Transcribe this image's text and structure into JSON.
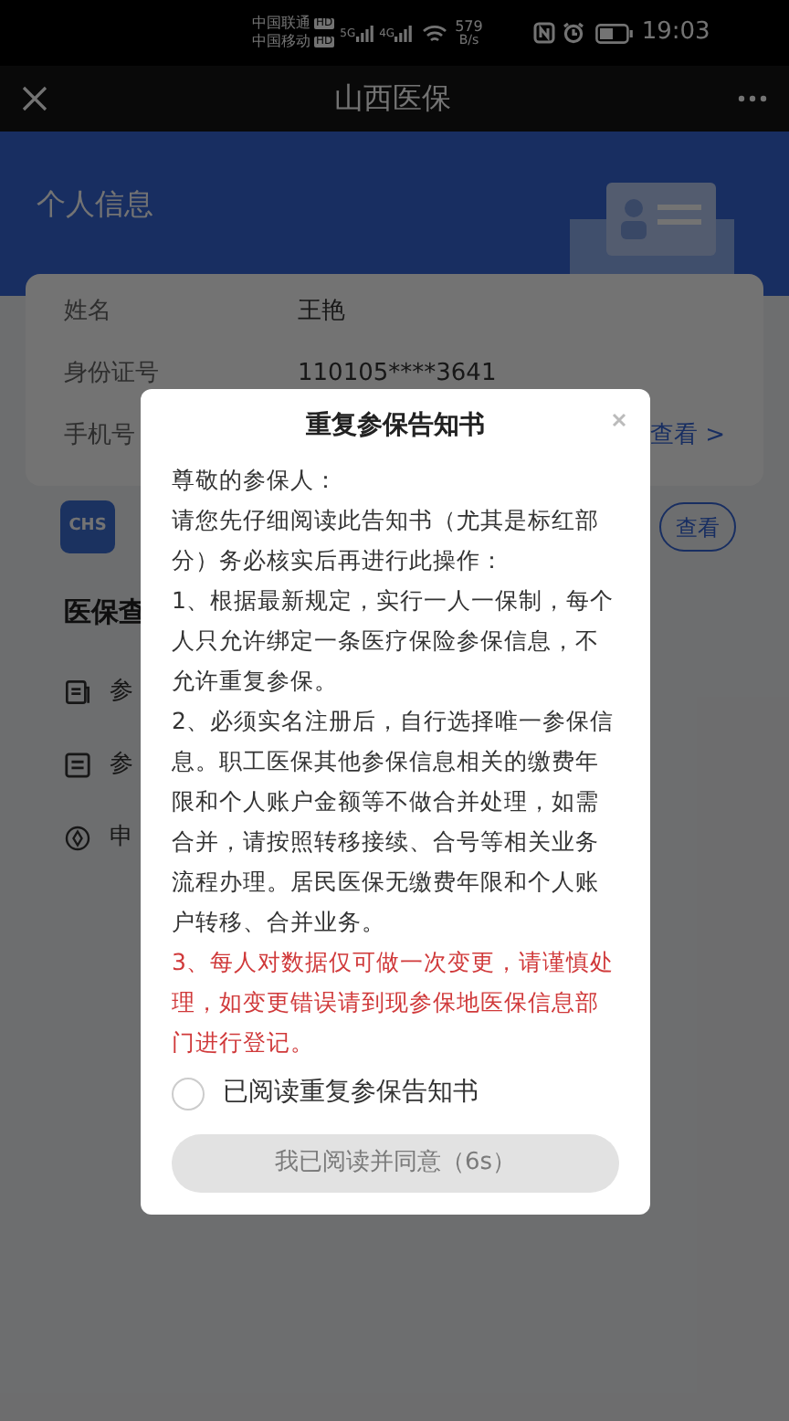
{
  "status_bar": {
    "carriers": [
      {
        "name": "中国联通",
        "badge": "HD"
      },
      {
        "name": "中国移动",
        "badge": "HD"
      }
    ],
    "networks": [
      "5G",
      "4G"
    ],
    "speed": "579",
    "speed_unit": "B/s",
    "time": "19:03"
  },
  "nav": {
    "title": "山西医保"
  },
  "personal": {
    "title": "个人信息",
    "rows": [
      {
        "label": "姓名",
        "value": "王艳"
      },
      {
        "label": "身份证号",
        "value": "110105****3641"
      },
      {
        "label": "手机号",
        "link": "查看 >"
      }
    ]
  },
  "card_row": {
    "logo_text": "CHS",
    "button": "查看"
  },
  "query": {
    "title": "医保查",
    "items": [
      {
        "kind": "doc",
        "label": "参"
      },
      {
        "kind": "list",
        "label": "参"
      },
      {
        "kind": "compass",
        "label": "申"
      }
    ]
  },
  "modal": {
    "title": "重复参保告知书",
    "paragraphs": [
      {
        "kind": "normal",
        "text": "尊敬的参保人："
      },
      {
        "kind": "normal",
        "text": "请您先仔细阅读此告知书（尤其是标红部分）务必核实后再进行此操作："
      },
      {
        "kind": "normal",
        "text": "1、根据最新规定，实行一人一保制，每个人只允许绑定一条医疗保险参保信息，不允许重复参保。"
      },
      {
        "kind": "normal",
        "text": "2、必须实名注册后，自行选择唯一参保信息。职工医保其他参保信息相关的缴费年限和个人账户金额等不做合并处理，如需合并，请按照转移接续、合号等相关业务流程办理。居民医保无缴费年限和个人账户转移、合并业务。"
      },
      {
        "kind": "warning",
        "text": "3、每人对数据仅可做一次变更，请谨慎处理，如变更错误请到现参保地医保信息部门进行登记。"
      }
    ],
    "checkbox": {
      "label": "已阅读重复参保告知书",
      "checked": false
    },
    "button": {
      "label": "我已阅读并同意（6s）",
      "disabled": true
    }
  }
}
